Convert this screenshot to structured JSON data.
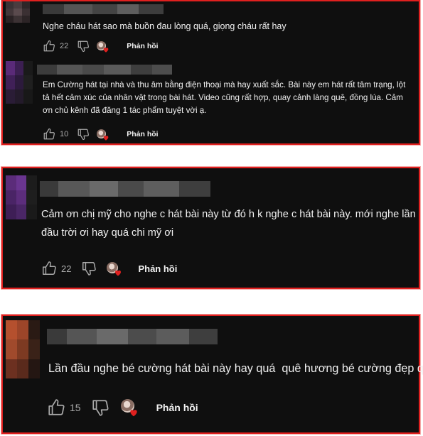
{
  "colors": {
    "card_bg": "#0f0f0f",
    "border": "#e0201f",
    "text": "#f1f1f1",
    "muted": "#aaaaaa",
    "heart": "#e0201f"
  },
  "comments": [
    {
      "text": "Nghe cháu hát sao mà buồn đau lòng quá, giọng cháu rất hay",
      "likes": "22",
      "reply_label": "Phản hồi"
    },
    {
      "text": "Em Cường hát tại nhà và thu âm bằng điện thoại mà hay xuất sắc. Bài này em hát rất tâm trạng, lột tả hết cảm xúc của nhân vật trong bài hát. Video cũng rất hợp, quay cảnh làng quê, đồng lúa. Cảm ơn chủ kênh đã đăng 1 tác phẩm tuyệt vời ạ.",
      "likes": "10",
      "reply_label": "Phản hồi"
    },
    {
      "text": "Cảm ơn chị mỹ cho nghe c hát bài này từ đó h k nghe c hát bài này. mới nghe lần đầu trời ơi hay quá chi mỹ ơi",
      "likes": "22",
      "reply_label": "Phản hồi"
    },
    {
      "text": "Lần đầu nghe bé cường hát bài này hay quá  quê hương bé cường đẹp quá",
      "likes": "15",
      "reply_label": "Phản hồi"
    }
  ],
  "icons": {
    "like": "thumb-up-icon",
    "dislike": "thumb-down-icon",
    "creator_heart": "creator-heart-icon"
  }
}
